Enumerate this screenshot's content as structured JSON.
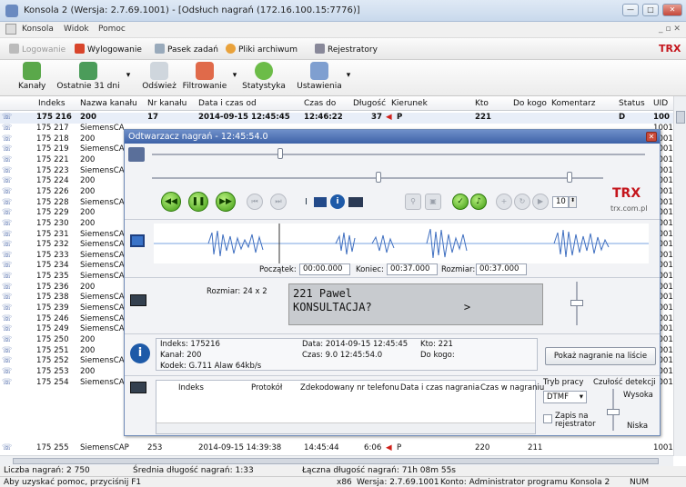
{
  "window": {
    "title": "Konsola 2 (Wersja: 2.7.69.1001) - [Odsłuch nagrań (172.16.100.15:7776)]"
  },
  "menu": [
    "Konsola",
    "Widok",
    "Pomoc"
  ],
  "toolbar1": {
    "logowanie": "Logowanie",
    "wylogowanie": "Wylogowanie",
    "pasek": "Pasek zadań",
    "archiwum": "Pliki archiwum",
    "rejestratory": "Rejestratory"
  },
  "toolbar2": [
    "Kanały",
    "Ostatnie 31 dni",
    "Odśwież",
    "Filtrowanie",
    "Statystyka",
    "Ustawienia"
  ],
  "grid": {
    "headers": [
      "Indeks",
      "Nazwa kanału",
      "Nr kanału",
      "Data i czas od",
      "Czas do",
      "Długość",
      "Kierunek",
      "Kto",
      "Do kogo",
      "Komentarz",
      "Status",
      "UID"
    ],
    "first": {
      "idx": "175 216",
      "name": "200",
      "nr": "17",
      "od": "2014-09-15 12:45:45",
      "do": "12:46:22",
      "len": "37",
      "dir": "P",
      "kto": "221",
      "status": "D",
      "uid": "100"
    },
    "rows": [
      [
        "175 217",
        "SiemensCA",
        "1001"
      ],
      [
        "175 218",
        "200",
        "1001"
      ],
      [
        "175 219",
        "SiemensCA",
        "1001"
      ],
      [
        "175 221",
        "200",
        "1001"
      ],
      [
        "175 223",
        "SiemensCA",
        "1001"
      ],
      [
        "175 224",
        "200",
        "1001"
      ],
      [
        "175 226",
        "200",
        "1001"
      ],
      [
        "175 228",
        "SiemensCA",
        "1001"
      ],
      [
        "175 229",
        "200",
        "1001"
      ],
      [
        "175 230",
        "200",
        "1001"
      ],
      [
        "175 231",
        "SiemensCA",
        "1001"
      ],
      [
        "175 232",
        "SiemensCA",
        "1001"
      ],
      [
        "175 233",
        "SiemensCA",
        "1001"
      ],
      [
        "175 234",
        "SiemensCA",
        "1001"
      ],
      [
        "175 235",
        "SiemensCA",
        "1001"
      ],
      [
        "175 236",
        "200",
        "1001"
      ],
      [
        "175 238",
        "SiemensCA",
        "1001"
      ],
      [
        "175 239",
        "SiemensCA",
        "1001"
      ],
      [
        "175 246",
        "SiemensCA",
        "1001"
      ],
      [
        "175 249",
        "SiemensCA",
        "1001"
      ],
      [
        "175 250",
        "200",
        "1001"
      ],
      [
        "175 251",
        "200",
        "1001"
      ],
      [
        "175 252",
        "SiemensCA",
        "1001"
      ],
      [
        "175 253",
        "200",
        "1001"
      ],
      [
        "175 254",
        "SiemensCA",
        "1001"
      ]
    ],
    "last": {
      "idx": "175 255",
      "name": "SiemensCAP",
      "nr": "253",
      "od": "2014-09-15 14:39:38",
      "do": "14:45:44",
      "len": "6:06",
      "dir": "P",
      "kto": "220",
      "kogo": "211",
      "uid": "1001"
    }
  },
  "status1": {
    "liczba": "Liczba nagrań: 2 750",
    "srednia": "Średnia długość nagrań: 1:33",
    "laczna": "Łączna długość nagrań: 71h 08m 55s"
  },
  "status2": {
    "help": "Aby uzyskać pomoc, przyciśnij F1",
    "arch": "x86",
    "ver": "Wersja: 2.7.69.1001",
    "konto": "Konto: Administrator programu Konsola 2",
    "num": "NUM"
  },
  "player": {
    "title": "Odtwarzacz nagrań - 12:45:54.0",
    "vol": "10",
    "brand": "trx.com.pl",
    "poczatek_l": "Początek:",
    "poczatek": "00:00.000",
    "koniec_l": "Koniec:",
    "koniec": "00:37.000",
    "rozmiar_l": "Rozmiar:",
    "rozmiar": "00:37.000",
    "display_size": "Rozmiar: 24 x 2",
    "lcd1": "221 Pawel",
    "lcd2": "KONSULTACJA?              >",
    "info": {
      "indeks": "Indeks: 175216",
      "kanal": "Kanał: 200",
      "kodek": "Kodek: G.711 Alaw 64kb/s",
      "data": "Data: 2014-09-15 12:45:45",
      "czas": "Czas: 9.0  12:45:54.0",
      "kto": "Kto: 221",
      "kogo": "Do kogo:"
    },
    "show_btn": "Pokaż nagranie na liście",
    "dtmf_headers": [
      "Indeks",
      "Protokół",
      "Zdekodowany nr telefonu",
      "Data i czas nagrania",
      "Czas w nagraniu"
    ],
    "tryb_l": "Tryb pracy",
    "tryb": "DTMF",
    "czulosc_l": "Czułość detekcji",
    "wysoka": "Wysoka",
    "niska": "Niska",
    "zapis": "Zapis na rejestrator"
  }
}
